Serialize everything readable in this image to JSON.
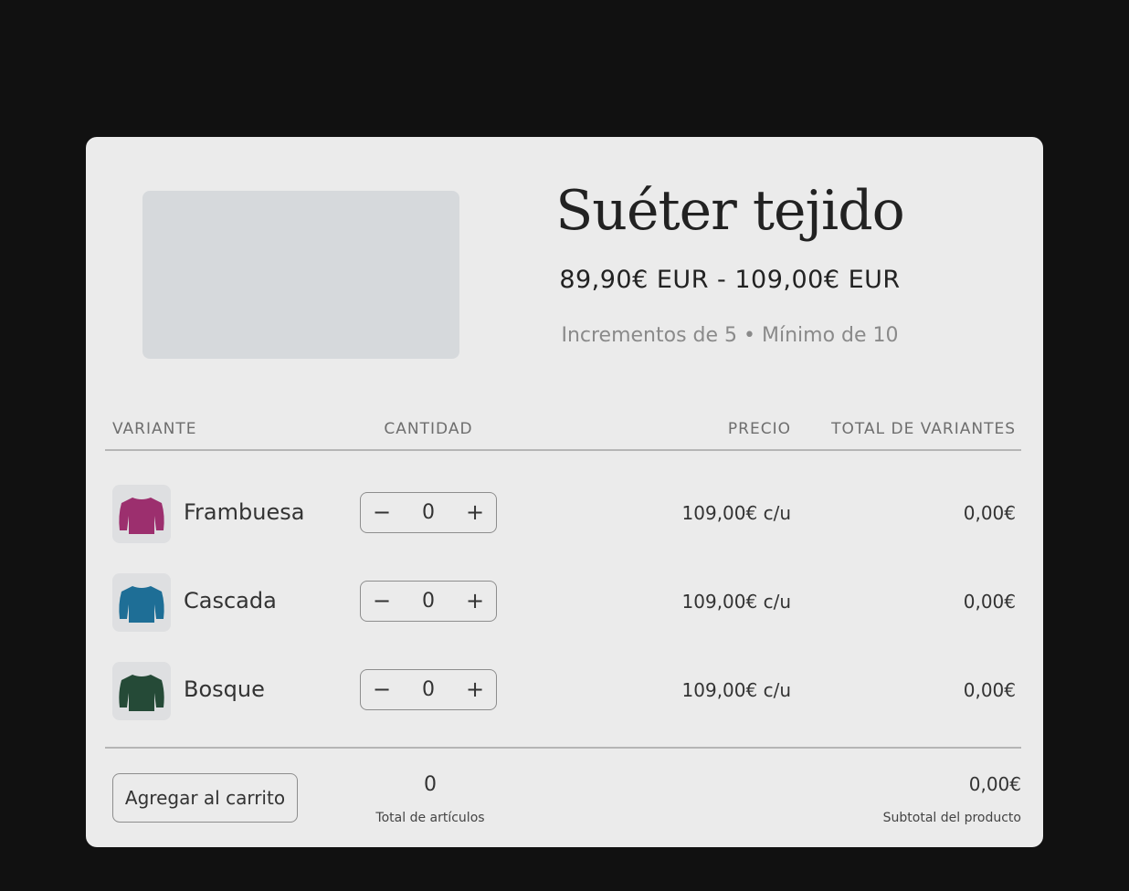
{
  "product": {
    "title": "Suéter tejido",
    "price_range": "89,90€ EUR - 109,00€ EUR",
    "rules": "Incrementos de 5 • Mínimo de 10"
  },
  "table": {
    "headers": {
      "variant": "VARIANTE",
      "quantity": "CANTIDAD",
      "price": "PRECIO",
      "total": "TOTAL DE VARIANTES"
    },
    "rows": [
      {
        "name": "Frambuesa",
        "color": "#9c2f6e",
        "quantity": "0",
        "minus": "−",
        "plus": "+",
        "unit_price": "109,00€ c/u",
        "total": "0,00€"
      },
      {
        "name": "Cascada",
        "color": "#1e6e96",
        "quantity": "0",
        "minus": "−",
        "plus": "+",
        "unit_price": "109,00€ c/u",
        "total": "0,00€"
      },
      {
        "name": "Bosque",
        "color": "#254a37",
        "quantity": "0",
        "minus": "−",
        "plus": "+",
        "unit_price": "109,00€ c/u",
        "total": "0,00€"
      }
    ]
  },
  "footer": {
    "cart_button": "Agregar al carrito",
    "total_items": "0",
    "total_items_label": "Total de artículos",
    "subtotal": "0,00€",
    "subtotal_label": "Subtotal del producto"
  }
}
